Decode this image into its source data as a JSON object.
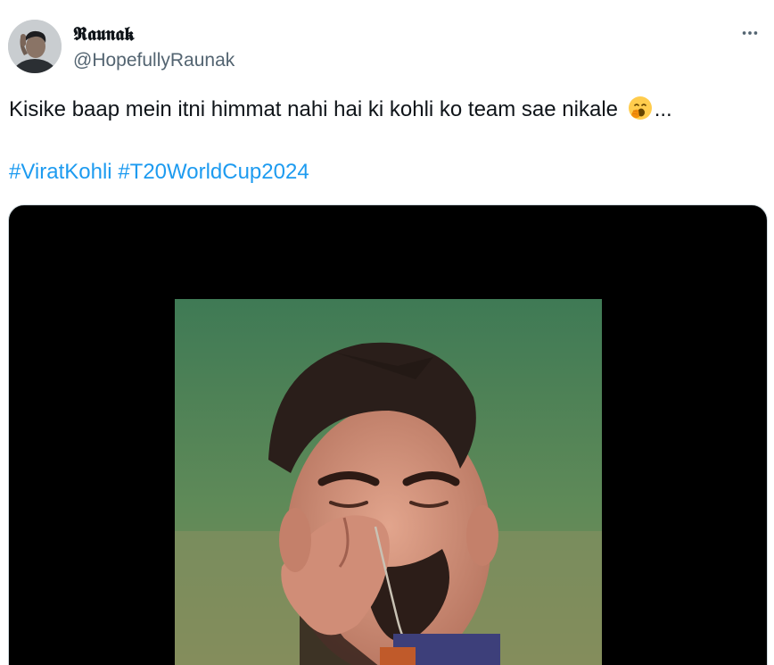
{
  "author": {
    "display_name": "𝕽𝖆𝖚𝖓𝖆𝖐",
    "handle": "@HopefullyRaunak",
    "avatar_icon": "person-avatar"
  },
  "menu": {
    "more_icon": "more-horizontal-icon"
  },
  "tweet": {
    "text_before_emoji": "Kisike baap mein itni himmat nahi hai ki kohli ko team sae nikale",
    "emoji_icon": "yawning-face-emoji",
    "text_after_emoji": "...",
    "hashtags": [
      "#ViratKohli",
      "#T20WorldCup2024"
    ]
  },
  "media": {
    "type": "video",
    "thumbnail_icon": "video-thumbnail-player-kissing-chain"
  },
  "colors": {
    "text": "#0f1419",
    "secondary": "#536471",
    "link": "#1d9bf0",
    "media_background": "#000000"
  }
}
